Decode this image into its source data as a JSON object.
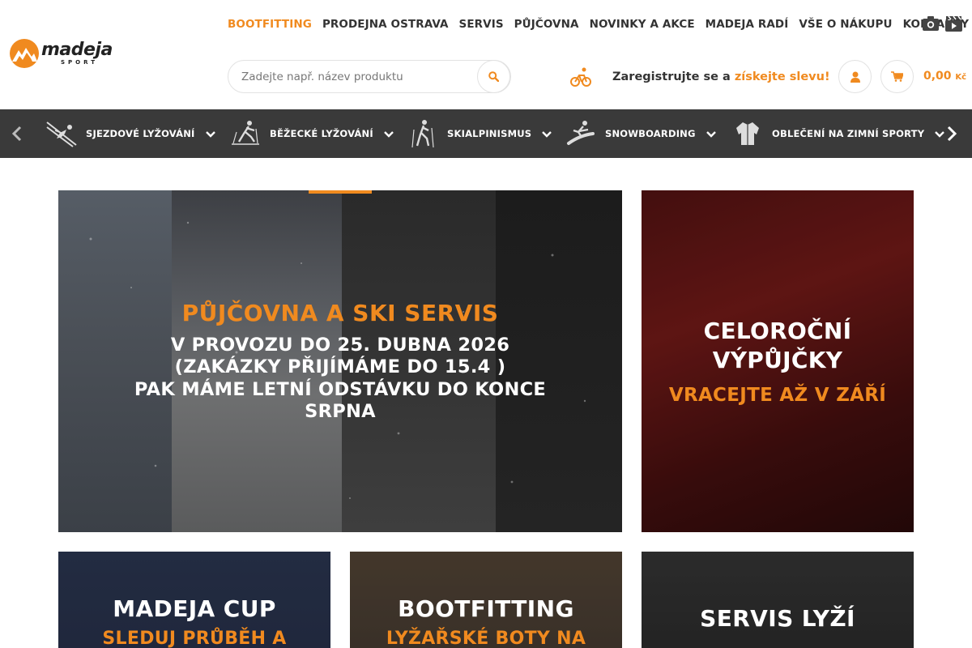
{
  "brand": {
    "logo_word": "madeja",
    "logo_sub": "SPORT"
  },
  "topnav": [
    {
      "label": "BOOTFITTING",
      "active": true
    },
    {
      "label": "PRODEJNA OSTRAVA",
      "active": false
    },
    {
      "label": "SERVIS",
      "active": false
    },
    {
      "label": "PŮJČOVNA",
      "active": false
    },
    {
      "label": "NOVINKY A AKCE",
      "active": false
    },
    {
      "label": "MADEJA RADÍ",
      "active": false
    },
    {
      "label": "VŠE O NÁKUPU",
      "active": false
    },
    {
      "label": "KONTAKTY",
      "active": false
    }
  ],
  "topnav_icons": [
    "camera-icon",
    "video-icon"
  ],
  "search": {
    "placeholder": "Zadejte např. název produktu",
    "value": ""
  },
  "promo": {
    "text": "Zaregistrujte se a",
    "link": "získejte slevu!",
    "icon": "cyclist-icon"
  },
  "cart": {
    "amount": "0,00",
    "currency": "Kč"
  },
  "categories": [
    {
      "label": "SJEZDOVÉ LYŽOVÁNÍ",
      "icon": "downhill-ski-icon"
    },
    {
      "label": "BĚŽECKÉ LYŽOVÁNÍ",
      "icon": "cross-country-ski-icon"
    },
    {
      "label": "SKIALPINISMUS",
      "icon": "ski-touring-icon"
    },
    {
      "label": "SNOWBOARDING",
      "icon": "snowboard-icon"
    },
    {
      "label": "OBLEČENÍ NA ZIMNÍ SPORTY",
      "icon": "jacket-icon"
    }
  ],
  "tiles": {
    "main": {
      "title": "PŮJČOVNA A SKI SERVIS",
      "line1": "V PROVOZU DO 25. DUBNA 2026",
      "line2": "(ZAKÁZKY PŘIJÍMÁME DO 15.4 )",
      "line3": "PAK MÁME LETNÍ ODSTÁVKU DO KONCE",
      "line4": "SRPNA"
    },
    "right": {
      "title1": "CELOROČNÍ",
      "title2": "VÝPŮJČKY",
      "sub": "VRACEJTE AŽ V ZÁŘÍ"
    },
    "b1": {
      "title": "MADEJA CUP",
      "sub": "SLEDUJ PRŮBĚH A"
    },
    "b2": {
      "title": "BOOTFITTING",
      "sub": "LYŽAŘSKÉ BOTY NA"
    },
    "b3": {
      "title": "SERVIS LYŽÍ",
      "sub": ""
    }
  },
  "colors": {
    "accent": "#f08a1f",
    "category_bar": "#3a3a3a",
    "text": "#333333"
  }
}
